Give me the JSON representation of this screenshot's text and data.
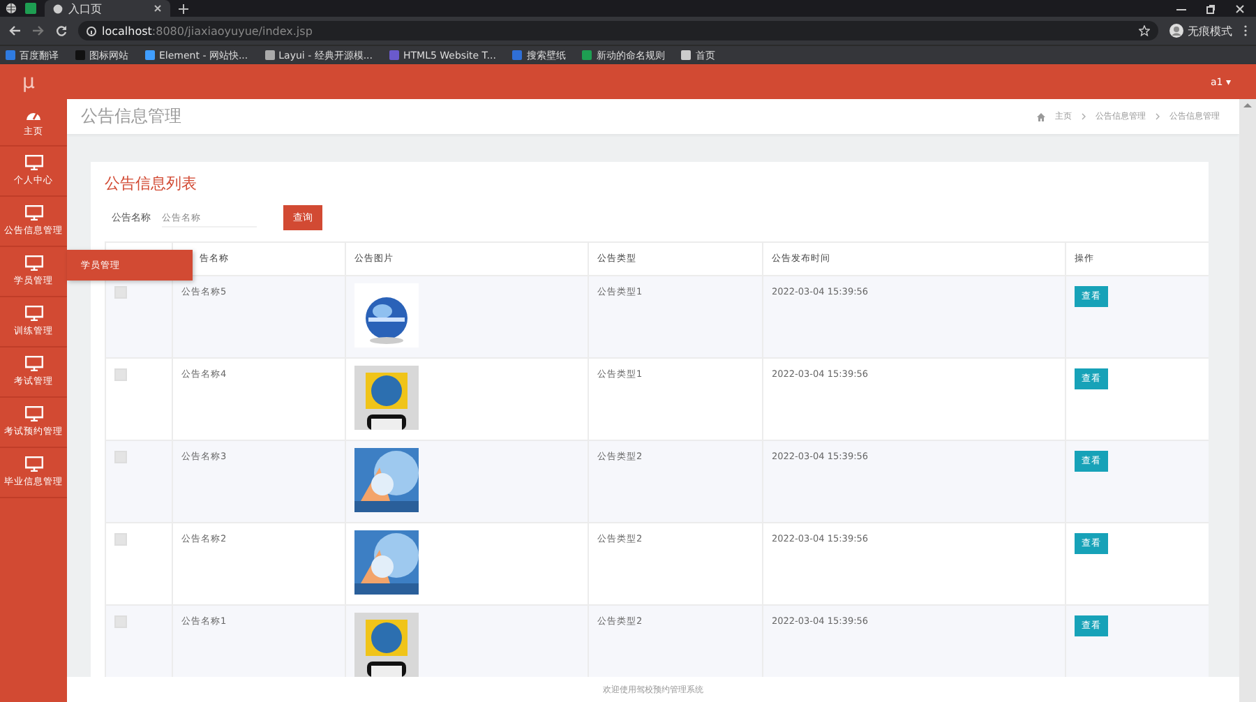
{
  "browser": {
    "tabs": [
      {
        "title": "入口页",
        "selected": true
      }
    ],
    "url_host": "localhost",
    "url_path": ":8080/jiaxiaoyuyue/index.jsp",
    "profile": "无痕模式",
    "bookmarks": [
      "百度翻译",
      "图标网站",
      "Element - 网站快...",
      "Layui - 经典开源模...",
      "HTML5 Website T...",
      "搜索壁纸",
      "新动的命名规则",
      "首页"
    ]
  },
  "header": {
    "logo": "µ",
    "user": "a1 ▾"
  },
  "nav": [
    {
      "label": "主页",
      "kind": "home"
    },
    {
      "label": "个人中心",
      "kind": "monitor"
    },
    {
      "label": "公告信息管理",
      "kind": "monitor"
    },
    {
      "label": "学员管理",
      "kind": "monitor"
    },
    {
      "label": "训练管理",
      "kind": "monitor"
    },
    {
      "label": "考试管理",
      "kind": "monitor"
    },
    {
      "label": "考试预约管理",
      "kind": "monitor"
    },
    {
      "label": "毕业信息管理",
      "kind": "monitor"
    }
  ],
  "flyout": {
    "label": "学员管理"
  },
  "page_title": "公告信息管理",
  "breadcrumb": [
    "主页",
    "公告信息管理",
    "公告信息管理"
  ],
  "list_title": "公告信息列表",
  "search": {
    "label": "公告名称",
    "placeholder": "公告名称",
    "button": "查询"
  },
  "table": {
    "columns": [
      "",
      "告名称",
      "公告图片",
      "公告类型",
      "公告发布时间",
      "操作"
    ],
    "rows": [
      {
        "checked": false,
        "name": "公告名称5",
        "type": "公告类型1",
        "time": "2022-03-04 15:39:56",
        "action": "查看"
      },
      {
        "checked": false,
        "name": "公告名称4",
        "type": "公告类型1",
        "time": "2022-03-04 15:39:56",
        "action": "查看"
      },
      {
        "checked": false,
        "name": "公告名称3",
        "type": "公告类型2",
        "time": "2022-03-04 15:39:56",
        "action": "查看"
      },
      {
        "checked": false,
        "name": "公告名称2",
        "type": "公告类型2",
        "time": "2022-03-04 15:39:56",
        "action": "查看"
      },
      {
        "checked": false,
        "name": "公告名称1",
        "type": "公告类型2",
        "time": "2022-03-04 15:39:56",
        "action": "查看"
      }
    ]
  },
  "footer": "欢迎使用驾校预约管理系统"
}
